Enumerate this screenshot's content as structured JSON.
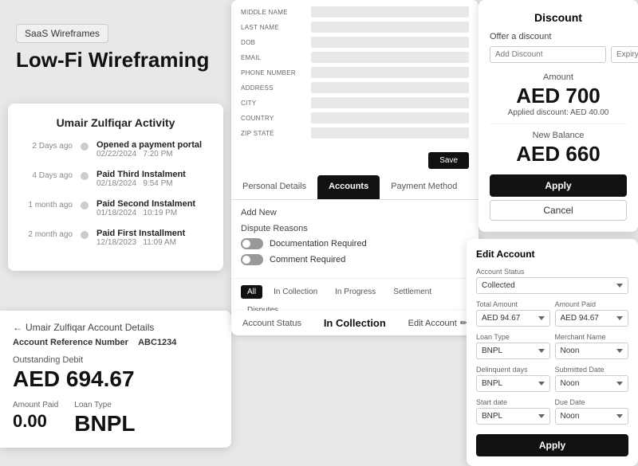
{
  "saas_tag": "SaaS Wireframes",
  "main_title": "Low-Fi Wireframing",
  "activity_card": {
    "title": "Umair Zulfiqar Activity",
    "items": [
      {
        "ago": "2 Days ago",
        "title": "Opened a payment portal",
        "date": "02/22/2024",
        "time": "7:20 PM"
      },
      {
        "ago": "4 Days ago",
        "title": "Paid Third Instalment",
        "date": "02/18/2024",
        "time": "9:54 PM"
      },
      {
        "ago": "1 month ago",
        "title": "Paid Second Instalment",
        "date": "01/18/2024",
        "time": "10:19 PM"
      },
      {
        "ago": "2 month ago",
        "title": "Paid First Installment",
        "date": "12/18/2023",
        "time": "11:09 AM"
      }
    ]
  },
  "account_details": {
    "back_label": "Umair Zulfiqar Account Details",
    "ref_label": "Account Reference Number",
    "ref_value": "ABC1234",
    "debit_label": "Outstanding Debit",
    "debit_amount": "AED 694.67",
    "amount_paid_label": "Amount Paid",
    "amount_paid_value": "0.00",
    "loan_type_label": "Loan Type",
    "loan_type_value": "BNPL"
  },
  "personal_form": {
    "fields": [
      {
        "label": "MIDDLE NAME"
      },
      {
        "label": "LAST NAME"
      },
      {
        "label": "DOB"
      },
      {
        "label": "EMAIL"
      },
      {
        "label": "PHONE NUMBER"
      },
      {
        "label": "ADDRESS"
      },
      {
        "label": "CITY"
      },
      {
        "label": "COUNTRY"
      },
      {
        "label": "ZIP STATE"
      }
    ],
    "save_label": "Save"
  },
  "tabs": {
    "personal_details": "Personal Details",
    "accounts": "Accounts",
    "payment_method": "Payment Method"
  },
  "accounts_tab": {
    "add_new": "Add New",
    "dispute_reasons": "Dispute Reasons",
    "toggles": [
      {
        "label": "Documentation Required"
      },
      {
        "label": "Comment Required"
      }
    ]
  },
  "filter_tabs": [
    {
      "label": "All",
      "active": true
    },
    {
      "label": "In Collection"
    },
    {
      "label": "In Progress"
    },
    {
      "label": "Settlement"
    },
    {
      "label": "Disputes"
    }
  ],
  "status_bar": {
    "label": "Account Status",
    "value": "In Collection",
    "edit_label": "Edit Account"
  },
  "discount_card": {
    "title": "Discount",
    "offer_label": "Offer a discount",
    "add_discount_placeholder": "Add Discount",
    "expiry_placeholder": "Expiry date D",
    "amount_section_title": "Amount",
    "amount_value": "AED 700",
    "applied_discount": "Applied discount: AED 40.00",
    "new_balance_title": "New Balance",
    "new_balance_value": "AED 660",
    "apply_label": "Apply",
    "cancel_label": "Cancel"
  },
  "edit_account_card": {
    "title": "Edit Account",
    "account_status_label": "Account Status",
    "account_status_value": "Collected",
    "total_amount_label": "Total Amount",
    "total_amount_value": "AED 94.67",
    "amount_paid_label": "Amount Paid",
    "amount_paid_value": "AED 94.67",
    "loan_type_label": "Loan Type",
    "loan_type_value": "BNPL",
    "merchant_name_label": "Merchant Name",
    "merchant_name_value": "Noon",
    "delinquent_days_label": "Delinquent days",
    "delinquent_days_value": "BNPL",
    "submitted_date_label": "Submitted Date",
    "submitted_date_value": "Noon",
    "start_date_label": "Start date",
    "start_date_value": "BNPL",
    "due_date_label": "Due Date",
    "due_date_value": "Noon",
    "apply_label": "Apply"
  }
}
